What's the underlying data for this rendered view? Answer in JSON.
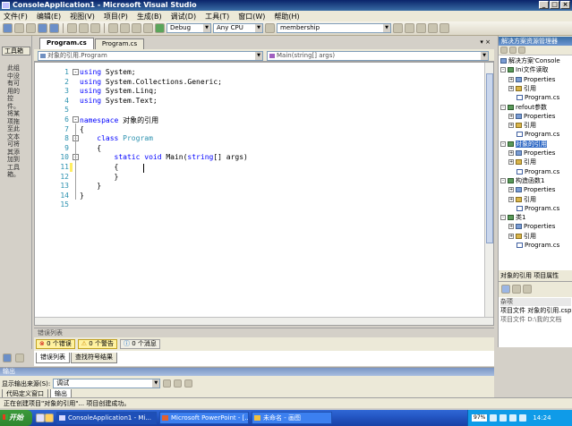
{
  "window": {
    "title": "ConsoleApplication1 - Microsoft Visual Studio",
    "buttons": [
      "_",
      "□",
      "×"
    ]
  },
  "menu": [
    "文件(F)",
    "编辑(E)",
    "视图(V)",
    "项目(P)",
    "生成(B)",
    "调试(D)",
    "工具(T)",
    "窗口(W)",
    "帮助(H)"
  ],
  "toolbar": {
    "config": "Debug",
    "platform": "Any CPU",
    "find": "membership"
  },
  "toolbox": {
    "tab": "工具箱",
    "hint": "此组中没有可用的控件。将某项拖至此文本可将其添加到工具箱。"
  },
  "editor": {
    "tabs": [
      "Program.cs",
      "Program.cs"
    ],
    "tab_close": "▾ ×",
    "nav_left": "对象的引用.Program",
    "nav_right": "Main(string[] args)",
    "lines": [
      {
        "n": "1",
        "parts": [
          {
            "t": "using ",
            "c": "kw"
          },
          {
            "t": "System;"
          }
        ]
      },
      {
        "n": "2",
        "parts": [
          {
            "t": "using ",
            "c": "kw"
          },
          {
            "t": "System.Collections.Generic;"
          }
        ]
      },
      {
        "n": "3",
        "parts": [
          {
            "t": "using ",
            "c": "kw"
          },
          {
            "t": "System.Linq;"
          }
        ]
      },
      {
        "n": "4",
        "parts": [
          {
            "t": "using ",
            "c": "kw"
          },
          {
            "t": "System.Text;"
          }
        ]
      },
      {
        "n": "5",
        "parts": [
          {
            "t": ""
          }
        ]
      },
      {
        "n": "6",
        "parts": [
          {
            "t": "namespace ",
            "c": "kw"
          },
          {
            "t": "对象的引用"
          }
        ]
      },
      {
        "n": "7",
        "parts": [
          {
            "t": "{"
          }
        ]
      },
      {
        "n": "8",
        "parts": [
          {
            "t": "    "
          },
          {
            "t": "class ",
            "c": "kw"
          },
          {
            "t": "Program",
            "c": "ty"
          }
        ]
      },
      {
        "n": "9",
        "parts": [
          {
            "t": "    {"
          }
        ]
      },
      {
        "n": "10",
        "parts": [
          {
            "t": "        "
          },
          {
            "t": "static void ",
            "c": "kw"
          },
          {
            "t": "Main("
          },
          {
            "t": "string",
            "c": "kw"
          },
          {
            "t": "[] args)"
          }
        ]
      },
      {
        "n": "11",
        "parts": [
          {
            "t": "        {"
          }
        ]
      },
      {
        "n": "12",
        "parts": [
          {
            "t": "        }"
          }
        ]
      },
      {
        "n": "13",
        "parts": [
          {
            "t": "    }"
          }
        ]
      },
      {
        "n": "14",
        "parts": [
          {
            "t": "}"
          }
        ]
      },
      {
        "n": "15",
        "parts": [
          {
            "t": ""
          }
        ]
      }
    ]
  },
  "solution_explorer": {
    "title": "解决方案资源管理器",
    "items": [
      {
        "label": "解决方案'Console",
        "indent": 0,
        "icon": "sln",
        "exp": ""
      },
      {
        "label": "Ini文件读取",
        "indent": 0,
        "icon": "proj",
        "exp": "-"
      },
      {
        "label": "Properties",
        "indent": 1,
        "icon": "",
        "exp": "+"
      },
      {
        "label": "引用",
        "indent": 1,
        "icon": "ref",
        "exp": "+"
      },
      {
        "label": "Program.cs",
        "indent": 2,
        "icon": "cs",
        "exp": ""
      },
      {
        "label": "refout参数",
        "indent": 0,
        "icon": "proj",
        "exp": "-"
      },
      {
        "label": "Properties",
        "indent": 1,
        "icon": "",
        "exp": "+"
      },
      {
        "label": "引用",
        "indent": 1,
        "icon": "ref",
        "exp": "+"
      },
      {
        "label": "Program.cs",
        "indent": 2,
        "icon": "cs",
        "exp": ""
      },
      {
        "label": "对象的引用",
        "indent": 0,
        "icon": "proj",
        "exp": "-",
        "selected": true
      },
      {
        "label": "Properties",
        "indent": 1,
        "icon": "",
        "exp": "+"
      },
      {
        "label": "引用",
        "indent": 1,
        "icon": "ref",
        "exp": "+"
      },
      {
        "label": "Program.cs",
        "indent": 2,
        "icon": "cs",
        "exp": ""
      },
      {
        "label": "构造函数1",
        "indent": 0,
        "icon": "proj",
        "exp": "-"
      },
      {
        "label": "Properties",
        "indent": 1,
        "icon": "",
        "exp": "+"
      },
      {
        "label": "引用",
        "indent": 1,
        "icon": "ref",
        "exp": "+"
      },
      {
        "label": "Program.cs",
        "indent": 2,
        "icon": "cs",
        "exp": ""
      },
      {
        "label": "类1",
        "indent": 0,
        "icon": "proj",
        "exp": "-"
      },
      {
        "label": "Properties",
        "indent": 1,
        "icon": "",
        "exp": "+"
      },
      {
        "label": "引用",
        "indent": 1,
        "icon": "ref",
        "exp": "+"
      },
      {
        "label": "Program.cs",
        "indent": 2,
        "icon": "cs",
        "exp": ""
      }
    ]
  },
  "properties": {
    "title": "对象的引用 项目属性",
    "section": "杂项",
    "rows": [
      "项目文件 对象的引用.csproj",
      "项目文件 D:\\我的文档"
    ]
  },
  "error_list": {
    "title": "错误列表",
    "errors": "0 个错误",
    "warnings": "0 个警告",
    "messages": "0 个消息"
  },
  "bottom_tabs": [
    "错误列表",
    "查找符号结果"
  ],
  "output": {
    "title": "输出",
    "source_label": "显示输出来源(S):",
    "source_value": "调试",
    "tabs": [
      "代码定义窗口",
      "输出"
    ]
  },
  "status": "正在创建项目\"对象的引用\"... 项目创建成功。",
  "taskbar": {
    "start": "开始",
    "tasks": [
      "ConsoleApplication1 - Mi...",
      "Microsoft PowerPoint - [...",
      "未命名 - 画图"
    ],
    "battery": "97%",
    "clock": "14:24"
  }
}
